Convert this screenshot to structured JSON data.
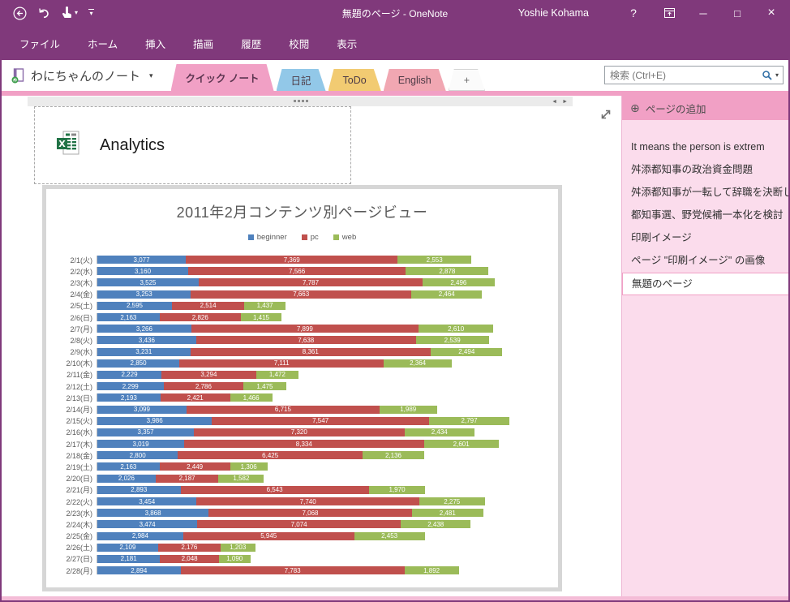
{
  "window": {
    "title": "無題のページ - OneNote",
    "user": "Yoshie Kohama",
    "controls": {
      "help": "?",
      "minimize": "─",
      "maximize": "□",
      "close": "×"
    }
  },
  "icons": {
    "chevron_down": "▾",
    "scroll_left": "◄",
    "scroll_right": "►",
    "add_page_plus": "⊕"
  },
  "ribbon": {
    "tabs": [
      {
        "id": "file",
        "label": "ファイル"
      },
      {
        "id": "home",
        "label": "ホーム"
      },
      {
        "id": "insert",
        "label": "挿入"
      },
      {
        "id": "draw",
        "label": "描画"
      },
      {
        "id": "history",
        "label": "履歴"
      },
      {
        "id": "review",
        "label": "校閲"
      },
      {
        "id": "view",
        "label": "表示"
      }
    ]
  },
  "notebook": {
    "name": "わにちゃんのノート",
    "sections": [
      {
        "id": "quick-notes",
        "label": "クイック ノート",
        "color": "#F1A0C5",
        "active": true
      },
      {
        "id": "diary",
        "label": "日記",
        "color": "#92C8E8",
        "active": false
      },
      {
        "id": "todo",
        "label": "ToDo",
        "color": "#F2CB72",
        "active": false
      },
      {
        "id": "english",
        "label": "English",
        "color": "#F1A7B2",
        "active": false
      }
    ],
    "add_section_label": "+",
    "accent_color": "#F1A0C5"
  },
  "search": {
    "placeholder": "検索 (Ctrl+E)"
  },
  "page": {
    "embed_title": "Analytics"
  },
  "sidebar": {
    "add_page_label": "ページの追加",
    "pages": [
      "It means the person is extrem",
      "舛添都知事の政治資金問題",
      "舛添都知事が一転して辞職を決断し",
      "都知事選、野党候補一本化を検討",
      "印刷イメージ",
      "ページ \"印刷イメージ\" の画像",
      "無題のページ"
    ],
    "selected_index": 6
  },
  "chart_data": {
    "type": "bar",
    "orientation": "horizontal",
    "stacked": true,
    "title": "2011年2月コンテンツ別ページビュー",
    "legend_position": "top",
    "xlim": [
      0,
      15200
    ],
    "grid": false,
    "categories": [
      "2/1(火)",
      "2/2(水)",
      "2/3(木)",
      "2/4(金)",
      "2/5(土)",
      "2/6(日)",
      "2/7(月)",
      "2/8(火)",
      "2/9(水)",
      "2/10(木)",
      "2/11(金)",
      "2/12(土)",
      "2/13(日)",
      "2/14(月)",
      "2/15(火)",
      "2/16(水)",
      "2/17(木)",
      "2/18(金)",
      "2/19(土)",
      "2/20(日)",
      "2/21(月)",
      "2/22(火)",
      "2/23(水)",
      "2/24(木)",
      "2/25(金)",
      "2/26(土)",
      "2/27(日)",
      "2/28(月)"
    ],
    "series": [
      {
        "name": "beginner",
        "color": "#4F81BD",
        "values": [
          3077,
          3160,
          3525,
          3253,
          2595,
          2163,
          3266,
          3436,
          3231,
          2850,
          2229,
          2299,
          2193,
          3099,
          3986,
          3357,
          3019,
          2800,
          2163,
          2026,
          2893,
          3454,
          3868,
          3474,
          2984,
          2109,
          2181,
          2894
        ]
      },
      {
        "name": "pc",
        "color": "#C0504D",
        "values": [
          7369,
          7566,
          7787,
          7663,
          2514,
          2826,
          7899,
          7638,
          8361,
          7111,
          3294,
          2786,
          2421,
          6715,
          7547,
          7320,
          8334,
          6425,
          2449,
          2187,
          6543,
          7740,
          7068,
          7074,
          5945,
          2176,
          2048,
          7783
        ]
      },
      {
        "name": "web",
        "color": "#9BBB59",
        "values": [
          2553,
          2878,
          2496,
          2464,
          1437,
          1415,
          2610,
          2539,
          2494,
          2364,
          1472,
          1475,
          1466,
          1989,
          2797,
          2434,
          2601,
          2136,
          1306,
          1582,
          1970,
          2275,
          2481,
          2438,
          2453,
          1203,
          1090,
          1892
        ]
      }
    ],
    "value_labels": "inside-segment, thousands comma format"
  }
}
